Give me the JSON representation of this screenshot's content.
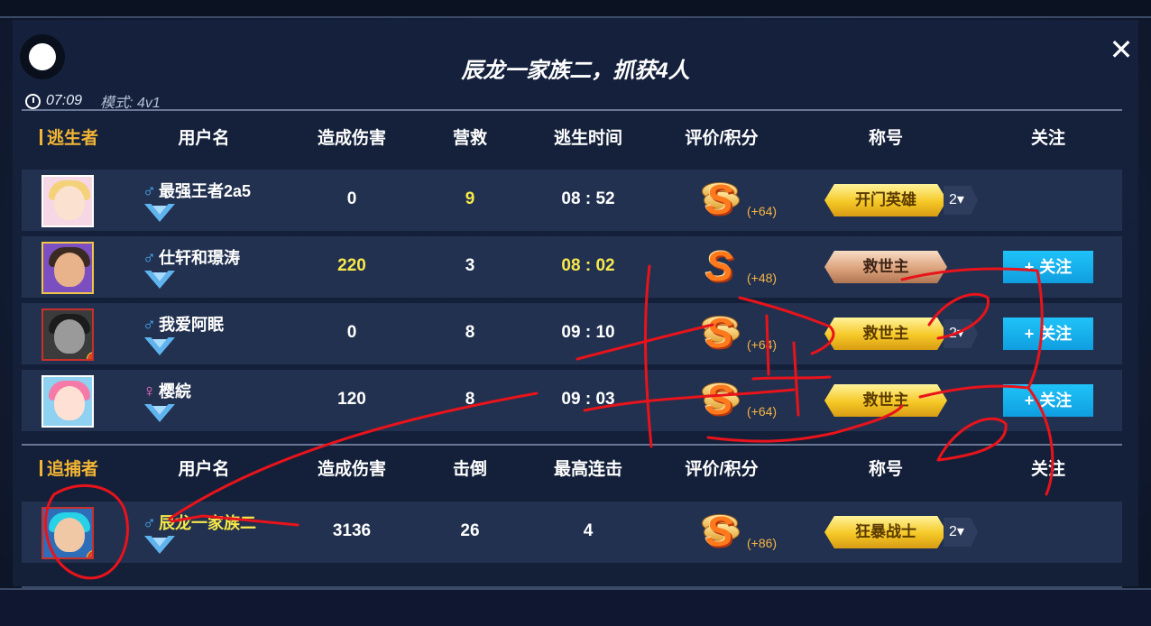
{
  "header": {
    "title": "辰龙一家族二，抓获4人",
    "time": "07:09",
    "mode": "模式: 4v1"
  },
  "survivors": {
    "role_label": "逃生者",
    "columns": [
      "用户名",
      "造成伤害",
      "营救",
      "逃生时间",
      "评价/积分",
      "称号",
      "关注"
    ],
    "rows": [
      {
        "name": "最强王者2a5",
        "sex": "male",
        "damage": "0",
        "rescue": "9",
        "escape_time": "08 : 52",
        "grade": "S",
        "points": "(+64)",
        "title": "开门英雄",
        "title_style": "gold",
        "level": "2",
        "follow": null
      },
      {
        "name": "仕轩和璟涛",
        "sex": "male",
        "damage": "220",
        "rescue": "3",
        "escape_time": "08 : 02",
        "grade": "S",
        "points": "(+48)",
        "title": "救世主",
        "title_style": "bronze",
        "level": null,
        "follow": "关注"
      },
      {
        "name": "我爱阿眠",
        "sex": "male",
        "damage": "0",
        "rescue": "8",
        "escape_time": "09 : 10",
        "grade": "S",
        "points": "(+64)",
        "title": "救世主",
        "title_style": "gold",
        "level": "2",
        "follow": "关注"
      },
      {
        "name": "樱綄",
        "sex": "female",
        "damage": "120",
        "rescue": "8",
        "escape_time": "09 : 03",
        "grade": "S",
        "points": "(+64)",
        "title": "救世主",
        "title_style": "gold",
        "level": null,
        "follow": "关注"
      }
    ]
  },
  "hunters": {
    "role_label": "追捕者",
    "columns": [
      "用户名",
      "造成伤害",
      "击倒",
      "最高连击",
      "评价/积分",
      "称号",
      "关注"
    ],
    "rows": [
      {
        "name": "辰龙一家族二",
        "sex": "male",
        "damage": "3136",
        "knockdowns": "26",
        "max_combo": "4",
        "grade": "S",
        "points": "(+86)",
        "title": "狂暴战士",
        "title_style": "gold",
        "level": "2",
        "follow": null
      }
    ]
  },
  "icons": {
    "close": "close-icon",
    "clock": "clock-icon",
    "male": "male-symbol-icon",
    "female": "female-symbol-icon",
    "rank": "rank-wings-icon"
  },
  "colors": {
    "role_label": "#f2b534",
    "highlight": "#f7e84a",
    "follow_button": "#1fc3f8",
    "scribble": "#e8131b"
  }
}
